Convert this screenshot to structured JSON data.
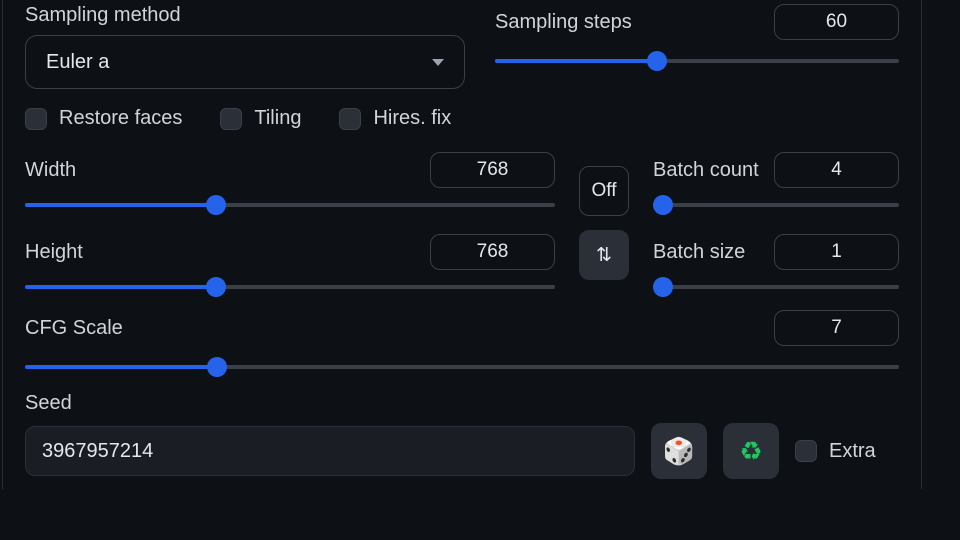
{
  "sampling": {
    "method_label": "Sampling method",
    "method_value": "Euler a",
    "steps_label": "Sampling steps",
    "steps_value": "60",
    "steps_fill_pct": 40
  },
  "checks": {
    "restore_faces_label": "Restore faces",
    "tiling_label": "Tiling",
    "hires_fix_label": "Hires. fix"
  },
  "dimensions": {
    "width_label": "Width",
    "width_value": "768",
    "width_fill_pct": 36,
    "height_label": "Height",
    "height_value": "768",
    "height_fill_pct": 36,
    "off_button": "Off",
    "swap_button": "⇅"
  },
  "batch": {
    "count_label": "Batch count",
    "count_value": "4",
    "count_fill_pct": 4,
    "size_label": "Batch size",
    "size_value": "1",
    "size_fill_pct": 4
  },
  "cfg": {
    "label": "CFG Scale",
    "value": "7",
    "fill_pct": 22
  },
  "seed": {
    "label": "Seed",
    "value": "3967957214",
    "dice_icon": "🎲",
    "recycle_icon": "♻",
    "extra_label": "Extra"
  }
}
